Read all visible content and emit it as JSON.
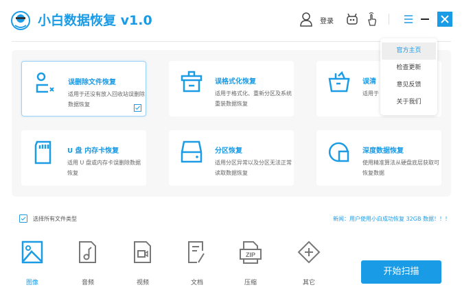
{
  "app": {
    "title": "小白数据恢复 v1.0",
    "login": "登录"
  },
  "colors": {
    "accent": "#1a9be6"
  },
  "menu": {
    "items": [
      "官方主页",
      "检查更新",
      "意见反馈",
      "关于我们"
    ]
  },
  "cards": [
    {
      "title": "误删除文件恢复",
      "desc": "适用于还没有放入回收站误删除数据恢复",
      "icon": "user-x-icon",
      "selected": true
    },
    {
      "title": "误格式化恢复",
      "desc": "适用于格式化、重新分区及系统重装数据恢复",
      "icon": "house-icon"
    },
    {
      "title": "误清",
      "desc": "适用于 失文件",
      "icon": "basket-icon"
    },
    {
      "title": "U 盘 内存卡恢复",
      "desc": "适用 U 盘或内存卡误删除数据恢复",
      "icon": "sd-card-icon"
    },
    {
      "title": "分区恢复",
      "desc": "适用分区异常以及分区无法正常读取数据恢复",
      "icon": "drive-icon"
    },
    {
      "title": "深度数据恢复",
      "desc": "使用精准算法从硬盘底层获取可恢复数据",
      "icon": "deep-scan-icon"
    }
  ],
  "select_all": {
    "label": "选择所有文件类型",
    "checked": true
  },
  "news": "新闻：用户使用小白成功恢复 32GB 数据！！！",
  "file_types": [
    {
      "label": "图像",
      "icon": "image-icon",
      "active": true
    },
    {
      "label": "音频",
      "icon": "audio-icon"
    },
    {
      "label": "视频",
      "icon": "video-icon"
    },
    {
      "label": "文档",
      "icon": "document-icon"
    },
    {
      "label": "压缩",
      "icon": "zip-icon"
    },
    {
      "label": "其它",
      "icon": "other-icon"
    }
  ],
  "scan_button": "开始扫描"
}
